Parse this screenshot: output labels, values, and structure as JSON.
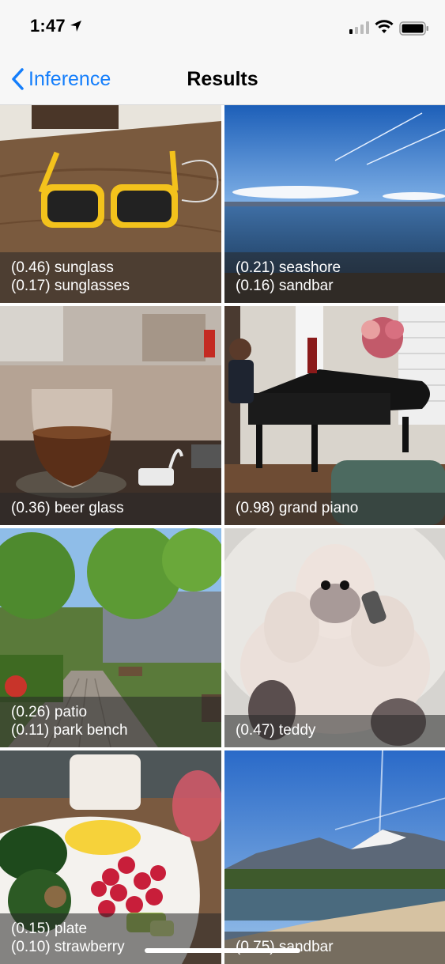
{
  "status_bar": {
    "time": "1:47"
  },
  "nav": {
    "back_label": "Inference",
    "title": "Results"
  },
  "results": [
    {
      "predictions": [
        "(0.46) sunglass",
        "(0.17) sunglasses"
      ]
    },
    {
      "predictions": [
        "(0.21) seashore",
        "(0.16) sandbar"
      ]
    },
    {
      "predictions": [
        "(0.36) beer glass"
      ]
    },
    {
      "predictions": [
        "(0.98) grand piano"
      ]
    },
    {
      "predictions": [
        "(0.26) patio",
        "(0.11) park bench"
      ]
    },
    {
      "predictions": [
        "(0.47) teddy"
      ]
    },
    {
      "predictions": [
        "(0.15) plate",
        "(0.10) strawberry"
      ]
    },
    {
      "predictions": [
        "(0.75) sandbar"
      ]
    }
  ],
  "colors": {
    "accent": "#147efb",
    "caption_overlay": "rgba(40,40,40,0.55)"
  }
}
